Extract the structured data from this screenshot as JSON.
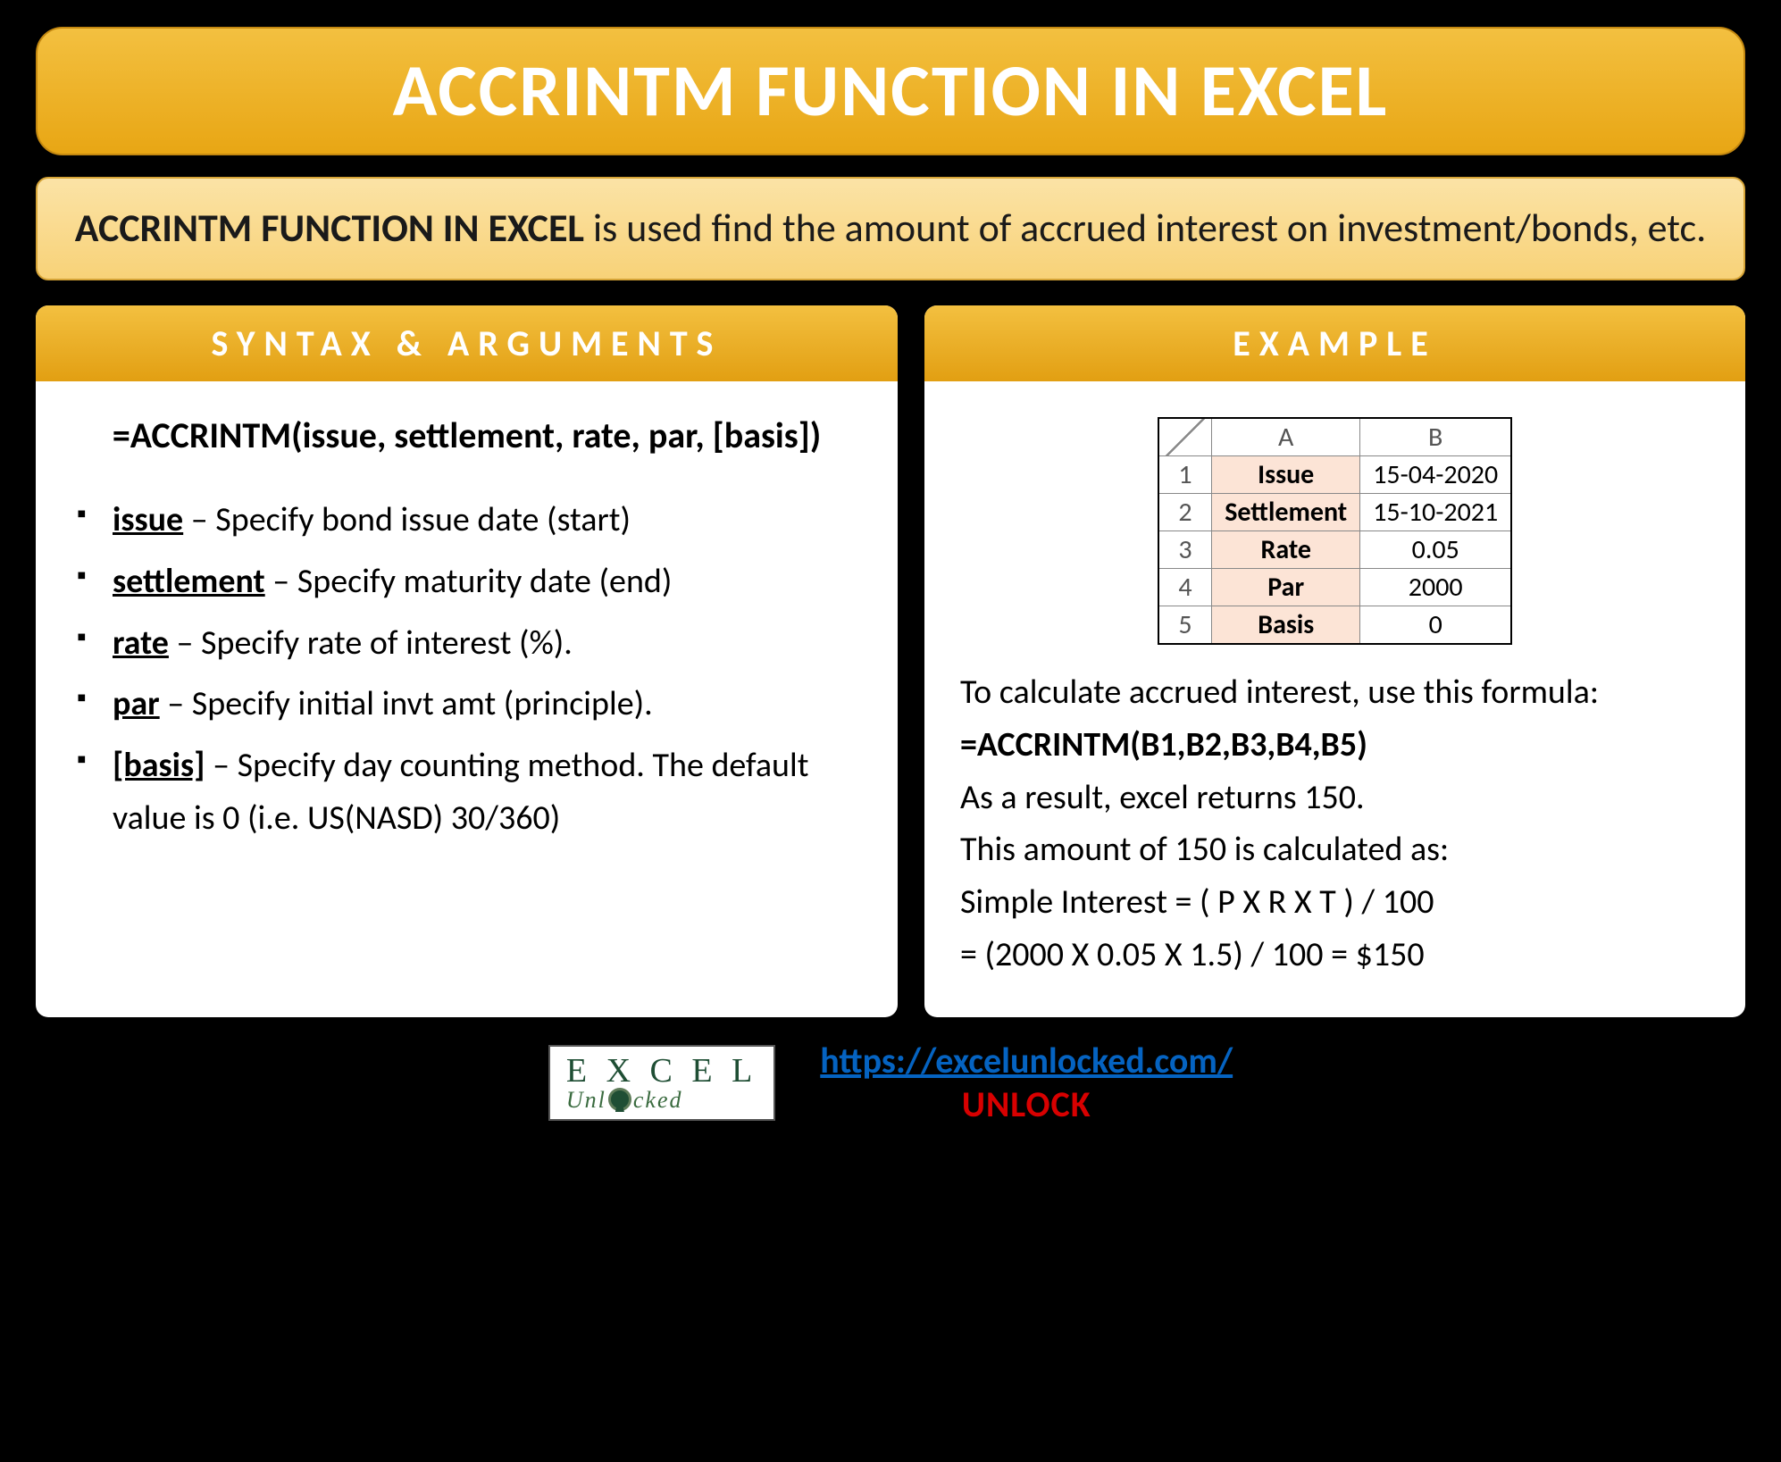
{
  "title": "ACCRINTM FUNCTION IN EXCEL",
  "description": {
    "heading": "ACCRINTM FUNCTION IN EXCEL",
    "body": " is used find the amount of accrued interest on investment/bonds, etc."
  },
  "syntax": {
    "header": "SYNTAX & ARGUMENTS",
    "formula": "=ACCRINTM(issue, settlement, rate, par, [basis])",
    "args": [
      {
        "term": "issue",
        "desc": " – Specify bond issue date (start)"
      },
      {
        "term": "settlement",
        "desc": " – Specify maturity date (end)"
      },
      {
        "term": "rate",
        "desc": " – Specify rate of interest (%)."
      },
      {
        "term": "par",
        "desc": " – Specify initial invt amt (principle)."
      },
      {
        "term": "[basis]",
        "desc": " – Specify day counting method. The default value is 0 (i.e. US(NASD) 30/360)"
      }
    ]
  },
  "example": {
    "header": "EXAMPLE",
    "table_cols": [
      "A",
      "B"
    ],
    "table_rows": [
      {
        "n": "1",
        "label": "Issue",
        "value": "15-04-2020"
      },
      {
        "n": "2",
        "label": "Settlement",
        "value": "15-10-2021"
      },
      {
        "n": "3",
        "label": "Rate",
        "value": "0.05"
      },
      {
        "n": "4",
        "label": "Par",
        "value": "2000"
      },
      {
        "n": "5",
        "label": "Basis",
        "value": "0"
      }
    ],
    "intro": "To calculate accrued interest, use this formula:",
    "formula": "=ACCRINTM(B1,B2,B3,B4,B5)",
    "result": "As a result, excel returns 150.",
    "calc1": "This amount of 150 is calculated as:",
    "calc2": "Simple Interest = ( P X R X T ) / 100",
    "calc3": "= (2000 X 0.05 X 1.5) / 100 = $150"
  },
  "footer": {
    "logo_top": "E X C E L",
    "logo_sub": "Unl   cked",
    "url": "https://excelunlocked.com/",
    "unlock": "UNLOCK"
  }
}
